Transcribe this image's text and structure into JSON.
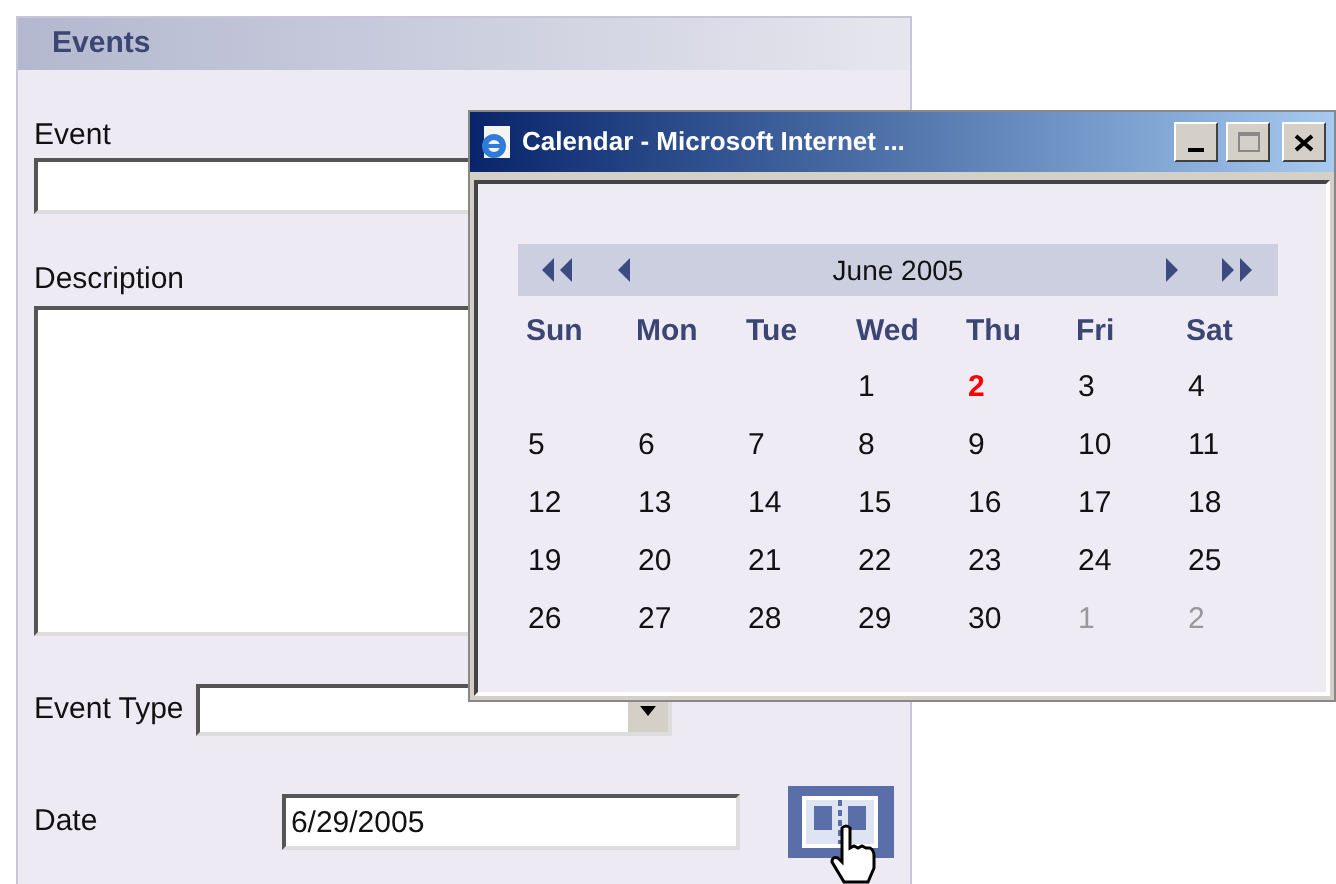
{
  "panel": {
    "title": "Events"
  },
  "form": {
    "event_label": "Event",
    "description_label": "Description",
    "type_label": "Event Type",
    "date_label": "Date",
    "date_value": "6/29/2005"
  },
  "popup": {
    "title": "Calendar - Microsoft Internet ...",
    "month": "June 2005",
    "weekdays": [
      "Sun",
      "Mon",
      "Tue",
      "Wed",
      "Thu",
      "Fri",
      "Sat"
    ],
    "weeks": [
      [
        {
          "kind": "blank"
        },
        {
          "kind": "blank"
        },
        {
          "kind": "blank"
        },
        {
          "kind": "day",
          "label": "1"
        },
        {
          "kind": "today",
          "label": "2"
        },
        {
          "kind": "day",
          "label": "3"
        },
        {
          "kind": "day",
          "label": "4"
        }
      ],
      [
        {
          "kind": "day",
          "label": "5"
        },
        {
          "kind": "day",
          "label": "6"
        },
        {
          "kind": "day",
          "label": "7"
        },
        {
          "kind": "day",
          "label": "8"
        },
        {
          "kind": "day",
          "label": "9"
        },
        {
          "kind": "day",
          "label": "10"
        },
        {
          "kind": "day",
          "label": "11"
        }
      ],
      [
        {
          "kind": "day",
          "label": "12"
        },
        {
          "kind": "day",
          "label": "13"
        },
        {
          "kind": "day",
          "label": "14"
        },
        {
          "kind": "day",
          "label": "15"
        },
        {
          "kind": "day",
          "label": "16"
        },
        {
          "kind": "day",
          "label": "17"
        },
        {
          "kind": "day",
          "label": "18"
        }
      ],
      [
        {
          "kind": "day",
          "label": "19"
        },
        {
          "kind": "day",
          "label": "20"
        },
        {
          "kind": "day",
          "label": "21"
        },
        {
          "kind": "day",
          "label": "22"
        },
        {
          "kind": "day",
          "label": "23"
        },
        {
          "kind": "day",
          "label": "24"
        },
        {
          "kind": "day",
          "label": "25"
        }
      ],
      [
        {
          "kind": "day",
          "label": "26"
        },
        {
          "kind": "day",
          "label": "27"
        },
        {
          "kind": "day",
          "label": "28"
        },
        {
          "kind": "day",
          "label": "29"
        },
        {
          "kind": "day",
          "label": "30"
        },
        {
          "kind": "other",
          "label": "1"
        },
        {
          "kind": "other",
          "label": "2"
        }
      ]
    ]
  }
}
